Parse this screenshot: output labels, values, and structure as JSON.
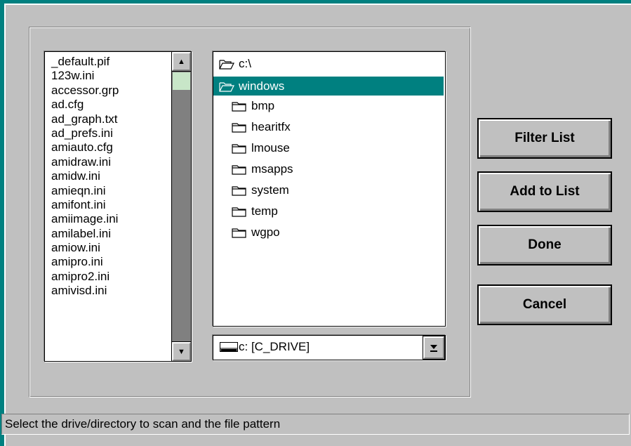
{
  "file_list": {
    "items": [
      "_default.pif",
      "123w.ini",
      "accessor.grp",
      "ad.cfg",
      "ad_graph.txt",
      "ad_prefs.ini",
      "amiauto.cfg",
      "amidraw.ini",
      "amidw.ini",
      "amieqn.ini",
      "amifont.ini",
      "amiimage.ini",
      "amilabel.ini",
      "amiow.ini",
      "amipro.ini",
      "amipro2.ini",
      "amivisd.ini"
    ]
  },
  "dir_list": {
    "items": [
      {
        "label": "c:\\",
        "icon": "open-folder-icon",
        "selected": false,
        "indent": 0
      },
      {
        "label": "windows",
        "icon": "open-folder-icon",
        "selected": true,
        "indent": 0
      },
      {
        "label": "bmp",
        "icon": "folder-icon",
        "selected": false,
        "indent": 1
      },
      {
        "label": "hearitfx",
        "icon": "folder-icon",
        "selected": false,
        "indent": 1
      },
      {
        "label": "lmouse",
        "icon": "folder-icon",
        "selected": false,
        "indent": 1
      },
      {
        "label": "msapps",
        "icon": "folder-icon",
        "selected": false,
        "indent": 1
      },
      {
        "label": "system",
        "icon": "folder-icon",
        "selected": false,
        "indent": 1
      },
      {
        "label": "temp",
        "icon": "folder-icon",
        "selected": false,
        "indent": 1
      },
      {
        "label": "wgpo",
        "icon": "folder-icon",
        "selected": false,
        "indent": 1
      }
    ]
  },
  "drive": {
    "value": "c: [C_DRIVE]",
    "icon": "hard-drive-icon"
  },
  "buttons": {
    "filter": "Filter List",
    "add": "Add to List",
    "done": "Done",
    "cancel": "Cancel"
  },
  "status": {
    "text": "Select the drive/directory to scan and the file pattern"
  },
  "colors": {
    "selection": "#008080",
    "background": "#c0c0c0"
  }
}
